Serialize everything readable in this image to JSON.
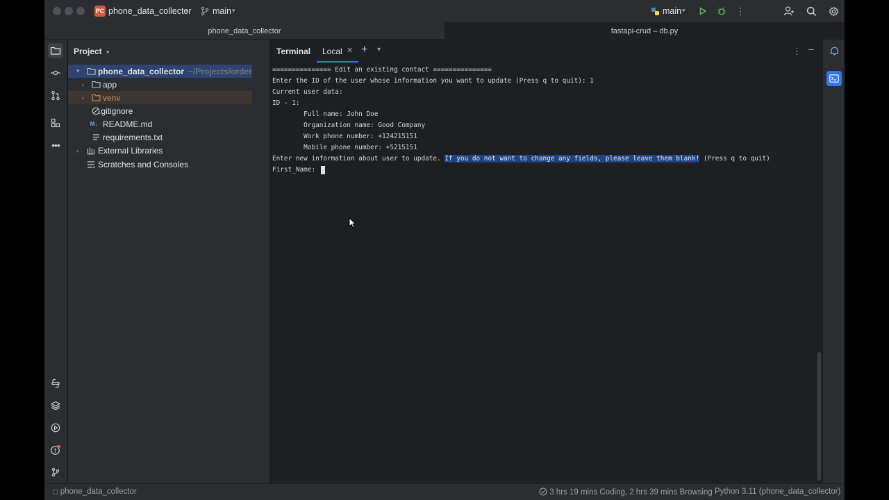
{
  "titlebar": {
    "project_badge": "PC",
    "project_name": "phone_data_collector",
    "branch": "main",
    "run_config": "main"
  },
  "editor_tabs": [
    {
      "label": "phone_data_collector"
    },
    {
      "label": "fastapi-crud – db.py"
    }
  ],
  "project_panel": {
    "header": "Project",
    "tree": [
      {
        "label": "phone_data_collector",
        "hint": "~/Projects/orders/scrip"
      },
      {
        "label": "app"
      },
      {
        "label": "venv"
      },
      {
        "label": ".gitignore"
      },
      {
        "label": "README.md"
      },
      {
        "label": "requirements.txt"
      },
      {
        "label": "External Libraries"
      },
      {
        "label": "Scratches and Consoles"
      }
    ]
  },
  "terminal": {
    "title": "Terminal",
    "tab_label": "Local",
    "lines": [
      "=============== Edit an existing contact ===============",
      "Enter the ID of the user whose information you want to update (Press q to quit): 1",
      "Current user data:",
      "ID - 1:",
      "        Full name: John Doe",
      "        Organization name: Good Company",
      "        Work phone number: +124215151",
      "        Mobile phone number: +5215151"
    ],
    "prompt_line": {
      "before": "Enter new information about user to update. ",
      "highlighted": "If you do not want to change any fields, please leave them blank!",
      "after": " (Press q to quit)"
    },
    "input_line": "First_Name: "
  },
  "statusbar": {
    "breadcrumb": "phone_data_collector",
    "time_tracking": "3 hrs 19 mins Coding, 2 hrs 39 mins Browsing",
    "interpreter": "Python 3.11 (phone_data_collector)"
  },
  "colors": {
    "accent": "#3574f0",
    "selection": "#2e436e",
    "highlight": "#214283",
    "notification": "#e55765"
  },
  "icons": {
    "titlebar": [
      "chevron-down-icon",
      "branch-icon",
      "python-icon",
      "run-icon",
      "debug-icon",
      "more-icon",
      "add-user-icon",
      "search-icon",
      "gear-icon"
    ],
    "left_strip": [
      "folder-icon",
      "commit-icon",
      "pull-request-icon",
      "structure-icon",
      "more-icon",
      "python-console-icon",
      "layers-icon",
      "services-icon",
      "problems-icon",
      "git-icon"
    ],
    "right_strip": [
      "notifications-icon",
      "terminal-icon"
    ]
  }
}
